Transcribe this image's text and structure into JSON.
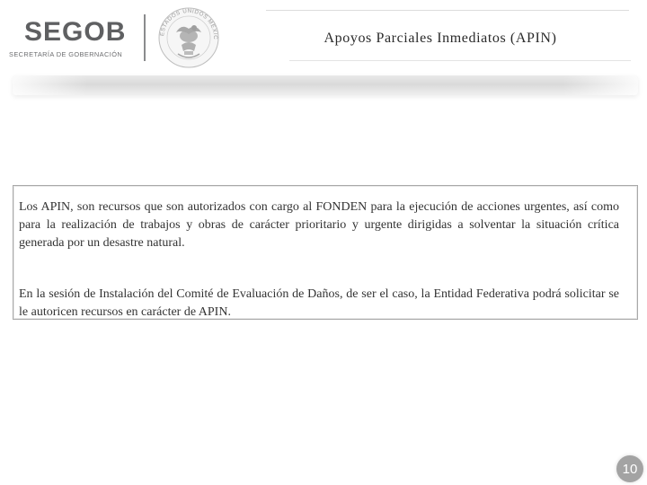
{
  "header": {
    "logo_wordmark": "SEGOB",
    "logo_subtitle": "SECRETARÍA DE GOBERNACIÓN",
    "seal_text": "ESTADOS UNIDOS MEXICANOS",
    "title": "Apoyos Parciales Inmediatos (APIN)"
  },
  "content": {
    "paragraphs": [
      "Los APIN, son recursos que son autorizados con cargo al FONDEN para la ejecución de acciones urgentes, así como para la realización de trabajos y obras de carácter prioritario y urgente dirigidas a solventar la situación crítica generada por un desastre natural.",
      "En la sesión de Instalación del Comité de Evaluación de Daños, de ser el caso, la Entidad Federativa podrá solicitar se le autoricen recursos en carácter de APIN."
    ]
  },
  "footer": {
    "page_number": "10"
  },
  "colors": {
    "logo_gray": "#5f6062",
    "page_badge": "#a3a3a3",
    "box_border": "#a9a9a9"
  },
  "icons": {
    "seal": "mexican-coat-of-arms-icon"
  }
}
